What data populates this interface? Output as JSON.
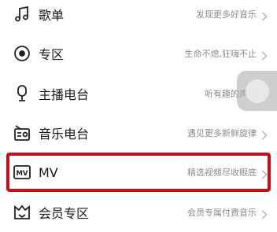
{
  "menu": {
    "items": [
      {
        "label": "歌单",
        "desc": "发现更多好音乐",
        "icon": "music-note-icon"
      },
      {
        "label": "专区",
        "desc": "生命不熄,狂嗨不止",
        "icon": "target-icon"
      },
      {
        "label": "主播电台",
        "desc": "听有趣的声音",
        "icon": "microphone-icon"
      },
      {
        "label": "音乐电台",
        "desc": "遇见更多新鲜旋律",
        "icon": "radio-icon"
      },
      {
        "label": "MV",
        "desc": "精选视频尽收眼底",
        "icon": "mv-icon"
      },
      {
        "label": "会员专区",
        "desc": "会员专属付费音乐",
        "icon": "vip-icon"
      }
    ]
  },
  "colors": {
    "highlight": "#c4121a",
    "text": "#1a1a1a",
    "desc": "#8c8c8c"
  }
}
